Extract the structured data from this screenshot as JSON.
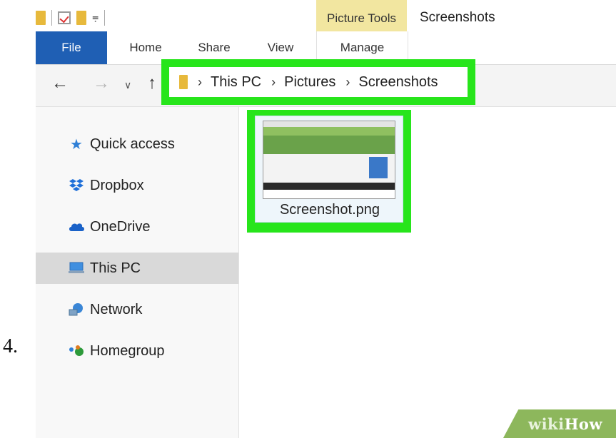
{
  "step": {
    "number": "4."
  },
  "window": {
    "title": "Screenshots",
    "contextual_tab_group": "Picture Tools"
  },
  "ribbon": {
    "tabs": [
      {
        "label": "File",
        "active": false
      },
      {
        "label": "Home"
      },
      {
        "label": "Share"
      },
      {
        "label": "View"
      },
      {
        "label": "Manage"
      }
    ]
  },
  "address_bar": {
    "breadcrumbs": [
      "This PC",
      "Pictures",
      "Screenshots"
    ],
    "highlight_color": "#27e51b"
  },
  "sidebar": {
    "items": [
      {
        "label": "Quick access",
        "icon": "star-icon"
      },
      {
        "label": "Dropbox",
        "icon": "dropbox-icon"
      },
      {
        "label": "OneDrive",
        "icon": "cloud-icon"
      },
      {
        "label": "This PC",
        "icon": "computer-icon",
        "selected": true
      },
      {
        "label": "Network",
        "icon": "network-icon"
      },
      {
        "label": "Homegroup",
        "icon": "homegroup-icon"
      }
    ]
  },
  "files": [
    {
      "name": "Screenshot.png",
      "icon": "image-thumbnail"
    }
  ],
  "watermark": {
    "part1": "wiki",
    "part2": "How"
  },
  "colors": {
    "file_tab": "#1f5fb4",
    "contextual_tab": "#f2e6a0",
    "selected_nav": "#d9d9d9",
    "folder": "#e7b93c"
  }
}
